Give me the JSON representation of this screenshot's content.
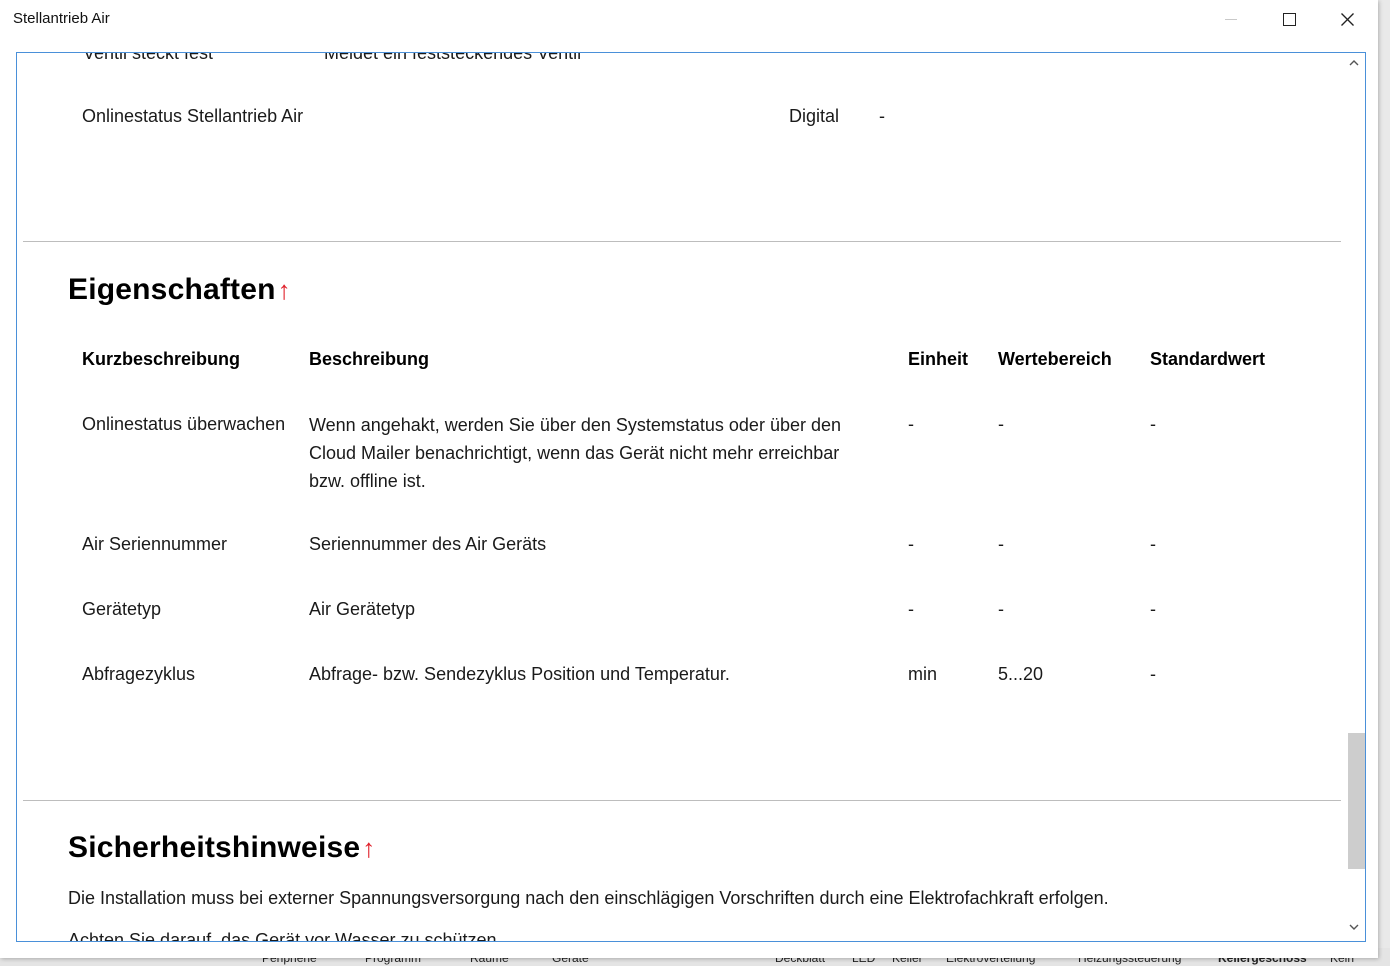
{
  "window": {
    "title": "Stellantrieb Air",
    "controls": {
      "minimize": "—",
      "close": "✕"
    }
  },
  "top_partial": {
    "left_text": "Ventil steckt fest",
    "right_text": "Meldet ein feststeckendes Ventil"
  },
  "online_row": {
    "name": "Onlinestatus Stellantrieb Air",
    "type": "Digital",
    "value": "-"
  },
  "eigenschaften": {
    "heading": "Eigenschaften",
    "arrow": "↑",
    "columns": [
      "Kurzbeschreibung",
      "Beschreibung",
      "Einheit",
      "Wertebereich",
      "Standardwert"
    ],
    "rows": [
      {
        "kurz": "Onlinestatus überwachen",
        "beschreibung": "Wenn angehakt, werden Sie über den Systemstatus oder über den Cloud Mailer benachrichtigt, wenn das Gerät nicht mehr erreichbar bzw. offline ist.",
        "einheit": "-",
        "wertebereich": "-",
        "standardwert": "-"
      },
      {
        "kurz": "Air Seriennummer",
        "beschreibung": "Seriennummer des Air Geräts",
        "einheit": "-",
        "wertebereich": "-",
        "standardwert": "-"
      },
      {
        "kurz": "Gerätetyp",
        "beschreibung": "Air Gerätetyp",
        "einheit": "-",
        "wertebereich": "-",
        "standardwert": "-"
      },
      {
        "kurz": "Abfragezyklus",
        "beschreibung": "Abfrage- bzw. Sendezyklus Position und Temperatur.",
        "einheit": "min",
        "wertebereich": "5...20",
        "standardwert": "-"
      }
    ]
  },
  "sicherheit": {
    "heading": "Sicherheitshinweise",
    "arrow": "↑",
    "text1": "Die Installation muss bei externer Spannungsversorgung nach den einschlägigen Vorschriften durch eine Elektrofachkraft erfolgen.",
    "text2": "Achten Sie darauf, das Gerät vor Wasser zu schützen."
  },
  "scrollbar": {
    "up": "⌃",
    "down": "⌄"
  },
  "background_tabs": [
    "Peripherie",
    "Programm",
    "Räume",
    "Geräte",
    "Deckblatt",
    "LED",
    "Keller",
    "Elektroverteilung",
    "Heizungssteuerung",
    "Kellergeschoss",
    "Kein"
  ]
}
